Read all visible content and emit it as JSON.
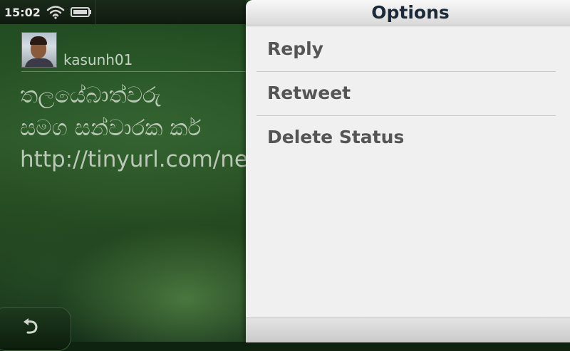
{
  "status_bar": {
    "time": "15:02"
  },
  "post": {
    "username": "kasunh01",
    "text_lines": [
      "තලයේබාත්වරු",
      "සමග සන්වාරක කර්",
      "http://tinyurl.com/ne"
    ]
  },
  "options_panel": {
    "title": "Options",
    "items": [
      {
        "label": "Reply"
      },
      {
        "label": "Retweet"
      },
      {
        "label": "Delete Status"
      }
    ]
  },
  "icons": {
    "wifi": "wifi-icon",
    "battery": "battery-icon",
    "back": "back-arrow-icon",
    "avatar": "user-avatar"
  }
}
